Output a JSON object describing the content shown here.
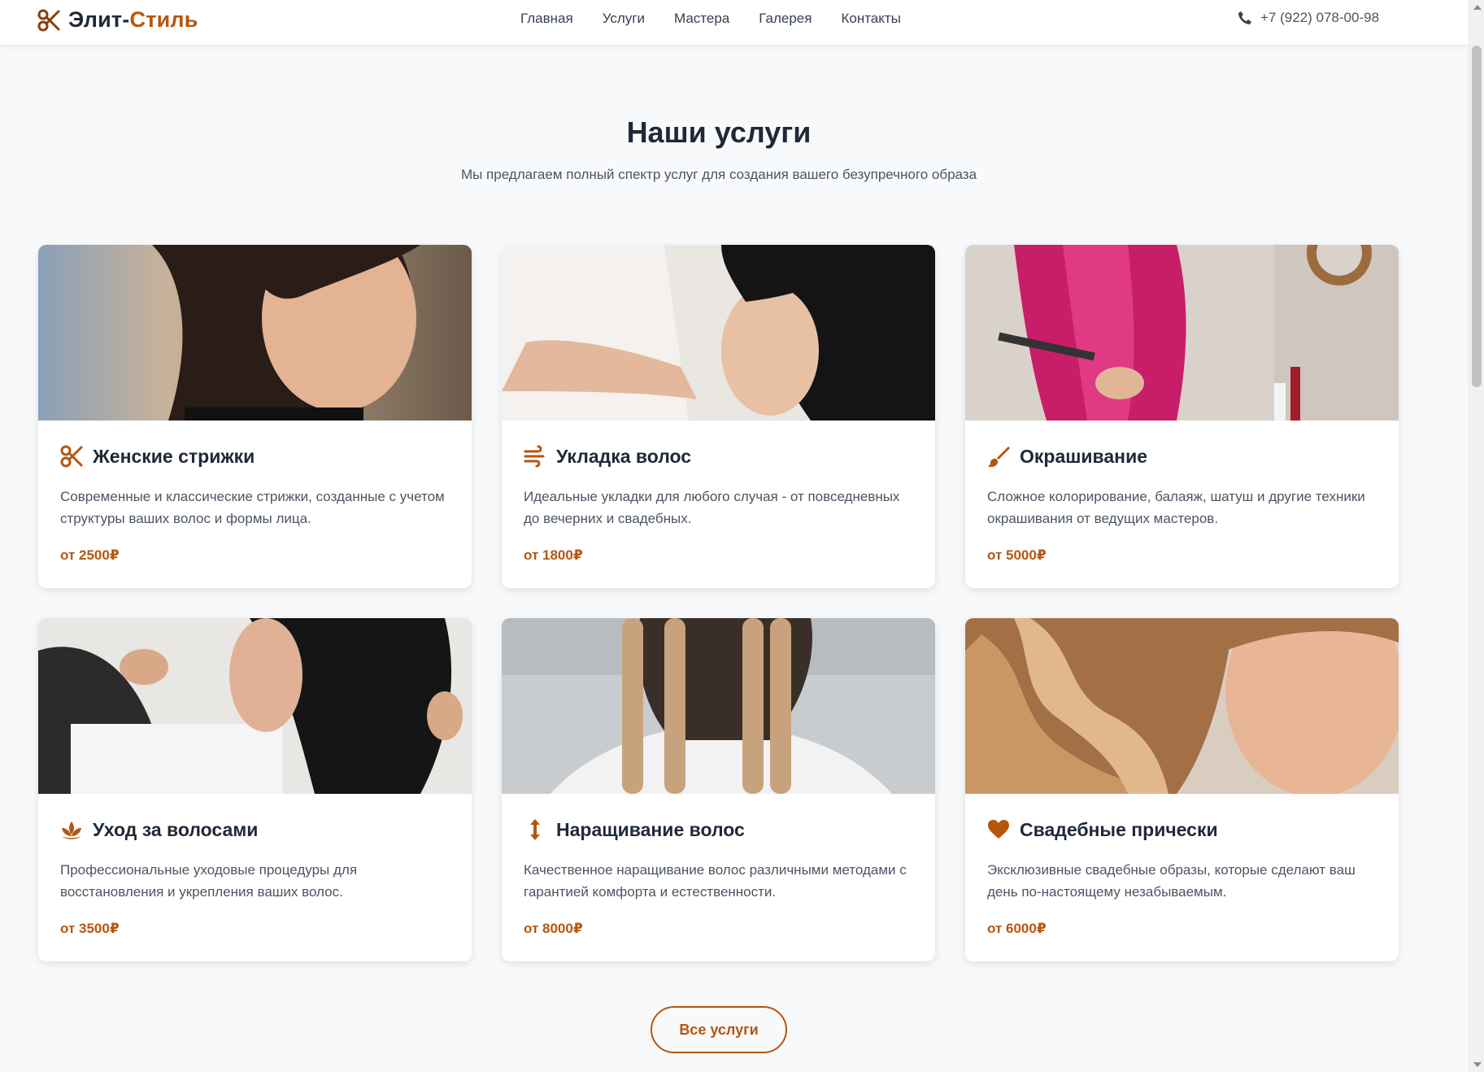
{
  "header": {
    "logo_part1": "Элит-",
    "logo_part2": "Стиль",
    "nav": [
      "Главная",
      "Услуги",
      "Мастера",
      "Галерея",
      "Контакты"
    ],
    "phone": "+7 (922) 078-00-98"
  },
  "section": {
    "title": "Наши услуги",
    "subtitle": "Мы предлагаем полный спектр услуг для создания вашего безупречного образа"
  },
  "services": [
    {
      "icon": "scissors-icon",
      "title": "Женские стрижки",
      "description": "Современные и классические стрижки, созданные с учетом структуры ваших волос и формы лица.",
      "price": "от 2500₽"
    },
    {
      "icon": "wind-icon",
      "title": "Укладка волос",
      "description": "Идеальные укладки для любого случая - от повседневных до вечерних и свадебных.",
      "price": "от 1800₽"
    },
    {
      "icon": "brush-icon",
      "title": "Окрашивание",
      "description": "Сложное колорирование, балаяж, шатуш и другие техники окрашивания от ведущих мастеров.",
      "price": "от 5000₽"
    },
    {
      "icon": "spa-icon",
      "title": "Уход за волосами",
      "description": "Профессиональные уходовые процедуры для восстановления и укрепления ваших волос.",
      "price": "от 3500₽"
    },
    {
      "icon": "arrows-vertical-icon",
      "title": "Наращивание волос",
      "description": "Качественное наращивание волос различными методами с гарантией комфорта и естественности.",
      "price": "от 8000₽"
    },
    {
      "icon": "heart-icon",
      "title": "Свадебные прически",
      "description": "Эксклюзивные свадебные образы, которые сделают ваш день по-настоящему незабываемым.",
      "price": "от 6000₽"
    }
  ],
  "all_services_button": "Все услуги",
  "colors": {
    "accent": "#b5560f",
    "text": "#1f2937",
    "muted": "#4b5563",
    "background": "#f8f9fa"
  }
}
